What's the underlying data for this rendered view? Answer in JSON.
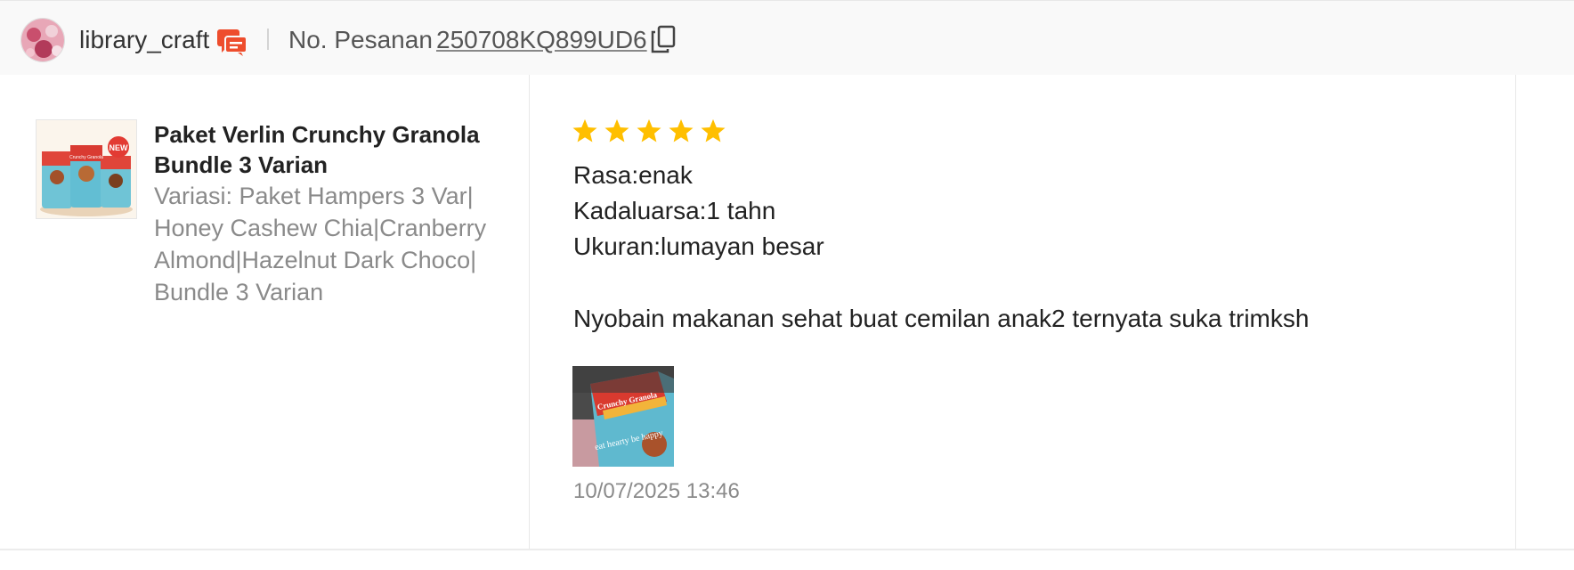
{
  "header": {
    "username": "library_craft",
    "order_label": "No. Pesanan",
    "order_number": "250708KQ899UD6"
  },
  "product": {
    "name": "Paket Verlin Crunchy Granola Bundle 3 Varian",
    "variant": "Variasi: Paket Hampers 3 Var|Honey Cashew Chia|Cranberry Almond|Hazelnut Dark Choco|Bundle 3 Varian",
    "image_texts": {
      "pack_title": "Crunchy Granola",
      "badge": "NEW"
    }
  },
  "review": {
    "rating": 5,
    "max_rating": 5,
    "star_color": "#ffbf00",
    "lines": [
      "Rasa:enak",
      "Kadaluarsa:1 tahn",
      "Ukuran:lumayan besar"
    ],
    "comment": "Nyobain makanan sehat buat cemilan anak2 ternyata suka trimksh",
    "photo_texts": {
      "pack_title": "Crunchy Granola",
      "pack_tagline": "eat hearty be happy"
    },
    "timestamp": "10/07/2025 13:46"
  },
  "icons": {
    "chat": "chat-bubbles-icon",
    "copy": "copy-icon",
    "star": "star-icon"
  },
  "colors": {
    "brand": "#ee4d2d",
    "header_bg": "#f9f9f9",
    "muted_text": "#8a8a8a"
  }
}
